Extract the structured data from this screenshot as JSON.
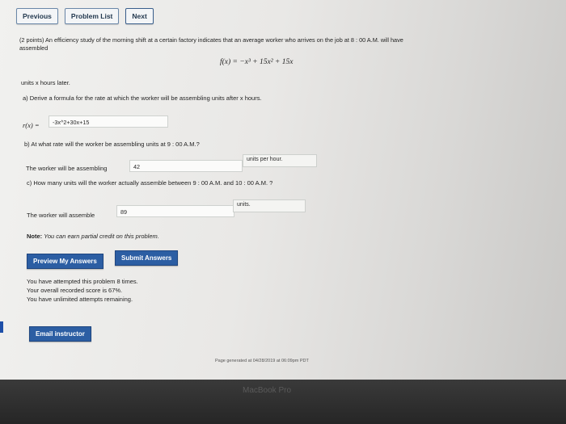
{
  "nav": {
    "previous_label": "Previous",
    "problem_list_label": "Problem List",
    "next_label": "Next"
  },
  "problem": {
    "intro_line1": "(2 points) An efficiency study of the morning shift at a certain factory indicates that an average worker who arrives on the job at 8 : 00 A.M. will have",
    "intro_line2": "assembled",
    "formula": "f(x) = −x³ + 15x² + 15x",
    "units_line": "units x hours later."
  },
  "part_a": {
    "question": "a) Derive a formula for the rate at which the worker will be assembling units after x hours.",
    "label": "r(x) =",
    "answer": "-3x^2+30x+15"
  },
  "part_b": {
    "question": "b) At what rate will the worker be assembling units at 9 : 00 A.M.?",
    "prefix": "The worker will be assembling",
    "answer": "42",
    "units": "units per hour."
  },
  "part_c": {
    "question": "c) How many units will the worker actually assemble between 9 : 00 A.M. and 10 : 00 A.M. ?",
    "prefix": "The worker will assemble",
    "answer": "89",
    "units": "units."
  },
  "note": {
    "label": "Note:",
    "text": "You can earn partial credit on this problem."
  },
  "actions": {
    "preview_label": "Preview My Answers",
    "submit_label": "Submit Answers"
  },
  "status": {
    "attempts_line": "You have attempted this problem 8 times.",
    "score_line": "Your overall recorded score is 67%.",
    "remaining_line": "You have unlimited attempts remaining."
  },
  "email_label": "Email instructor",
  "footer": {
    "generated": "Page generated at 04/28/2019 at 06:09pm PDT"
  },
  "bezel": {
    "brand": "MacBook Pro"
  }
}
